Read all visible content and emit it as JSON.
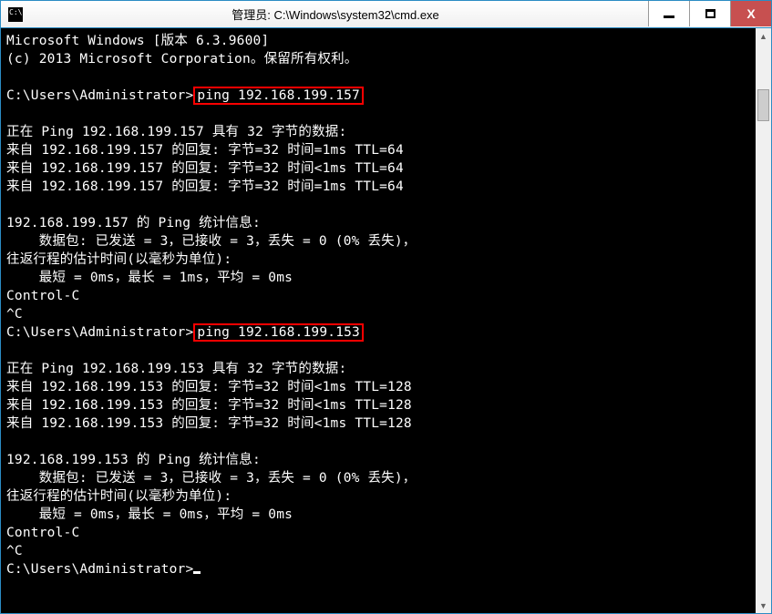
{
  "titlebar": {
    "title": "管理员: C:\\Windows\\system32\\cmd.exe",
    "min": "—",
    "max": "□",
    "close": "X"
  },
  "t": {
    "header1": "Microsoft Windows [版本 6.3.9600]",
    "header2": "(c) 2013 Microsoft Corporation。保留所有权利。",
    "prompt": "C:\\Users\\Administrator>",
    "cmd1": "ping 192.168.199.157",
    "ping1_head": "正在 Ping 192.168.199.157 具有 32 字节的数据:",
    "ping1_r1": "来自 192.168.199.157 的回复: 字节=32 时间=1ms TTL=64",
    "ping1_r2": "来自 192.168.199.157 的回复: 字节=32 时间<1ms TTL=64",
    "ping1_r3": "来自 192.168.199.157 的回复: 字节=32 时间=1ms TTL=64",
    "stat1_head": "192.168.199.157 的 Ping 统计信息:",
    "stat1_pk": "    数据包: 已发送 = 3，已接收 = 3，丢失 = 0 (0% 丢失)，",
    "stat1_rt1": "往返行程的估计时间(以毫秒为单位):",
    "stat1_rt2": "    最短 = 0ms，最长 = 1ms，平均 = 0ms",
    "ctrlc": "Control-C",
    "caretc": "^C",
    "cmd2": "ping 192.168.199.153",
    "ping2_head": "正在 Ping 192.168.199.153 具有 32 字节的数据:",
    "ping2_r1": "来自 192.168.199.153 的回复: 字节=32 时间<1ms TTL=128",
    "ping2_r2": "来自 192.168.199.153 的回复: 字节=32 时间<1ms TTL=128",
    "ping2_r3": "来自 192.168.199.153 的回复: 字节=32 时间<1ms TTL=128",
    "stat2_head": "192.168.199.153 的 Ping 统计信息:",
    "stat2_pk": "    数据包: 已发送 = 3，已接收 = 3，丢失 = 0 (0% 丢失)，",
    "stat2_rt1": "往返行程的估计时间(以毫秒为单位):",
    "stat2_rt2": "    最短 = 0ms，最长 = 0ms，平均 = 0ms"
  }
}
